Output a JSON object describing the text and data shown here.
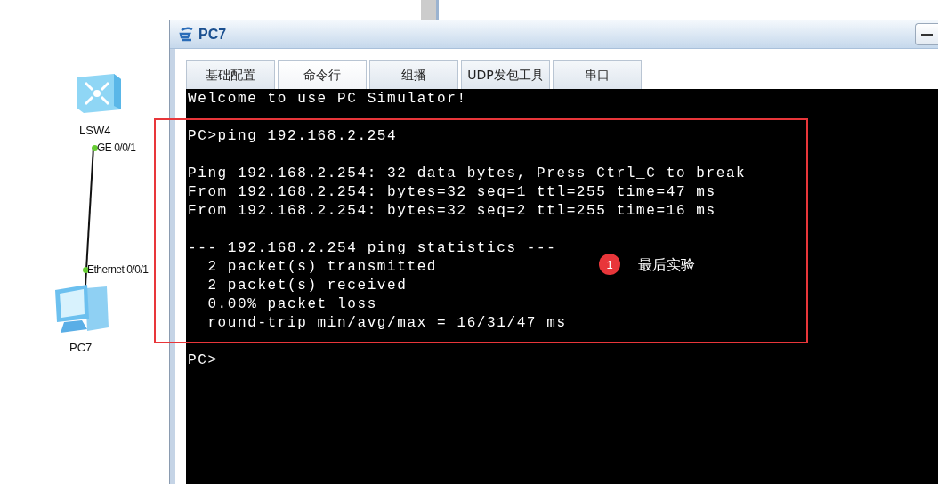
{
  "topology": {
    "nodes": [
      {
        "kind": "switch",
        "label": "LSW4"
      },
      {
        "kind": "pc",
        "label": "PC7"
      }
    ],
    "link": {
      "ports": [
        "GE 0/0/1",
        "Ethernet 0/0/1"
      ]
    }
  },
  "window": {
    "title": "PC7",
    "tabs": [
      {
        "label": "基础配置",
        "selected": false
      },
      {
        "label": "命令行",
        "selected": true
      },
      {
        "label": "组播",
        "selected": false
      },
      {
        "label": "UDP发包工具",
        "selected": false
      },
      {
        "label": "串口",
        "selected": false
      }
    ],
    "terminal": {
      "blocks": [
        [
          "Welcome to use PC Simulator!"
        ],
        [
          "PC>ping 192.168.2.254"
        ],
        [
          "Ping 192.168.2.254: 32 data bytes, Press Ctrl_C to break",
          "From 192.168.2.254: bytes=32 seq=1 ttl=255 time=47 ms",
          "From 192.168.2.254: bytes=32 seq=2 ttl=255 time=16 ms"
        ],
        [
          "--- 192.168.2.254 ping statistics ---",
          "  2 packet(s) transmitted",
          "  2 packet(s) received",
          "  0.00% packet loss",
          "  round-trip min/avg/max = 16/31/47 ms"
        ],
        [
          "PC>"
        ]
      ]
    }
  },
  "annotation": {
    "number": "1",
    "note": "最后实验"
  }
}
